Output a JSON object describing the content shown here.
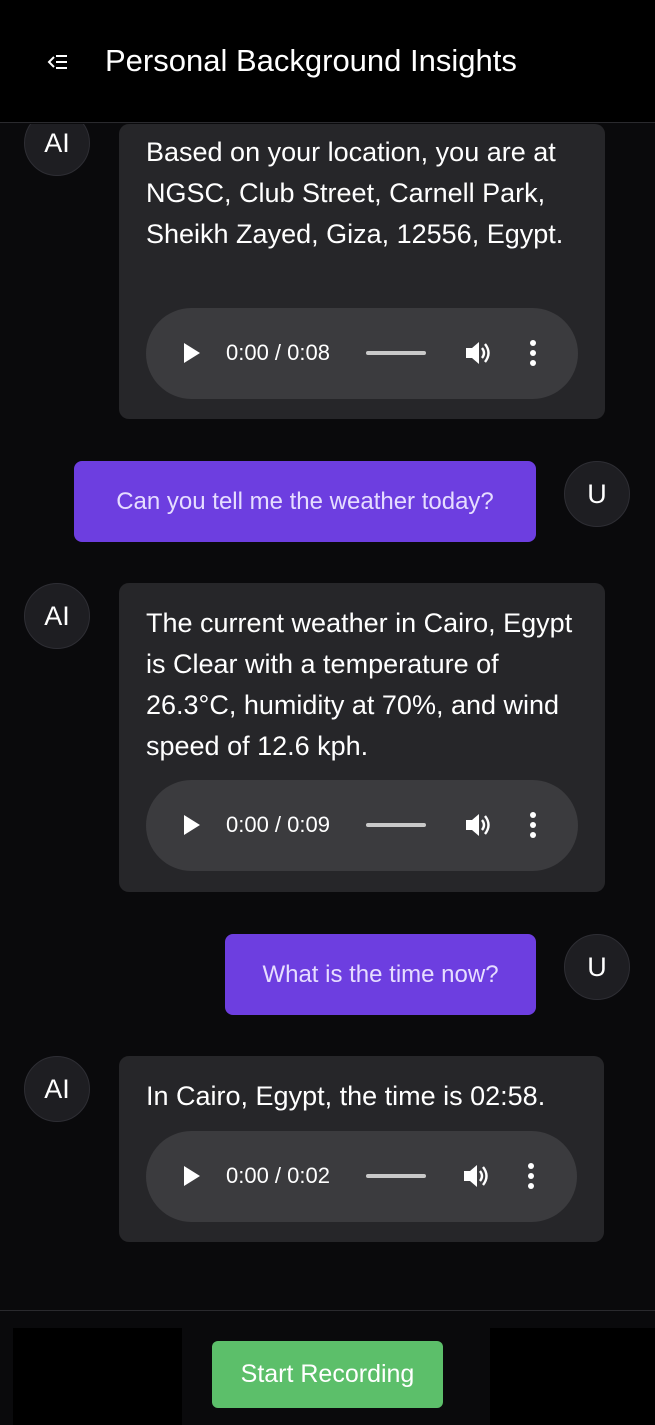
{
  "header": {
    "title": "Personal Background Insights",
    "menu_icon": "menu-collapse-icon"
  },
  "messages": [
    {
      "role": "ai",
      "avatar": "AI",
      "text": "Based on your location, you are at NGSC, Club Street, Carnell Park, Sheikh Zayed, Giza, 12556, Egypt.",
      "audio": {
        "current": "0:00",
        "duration": "0:08",
        "time_label": "0:00 / 0:08"
      }
    },
    {
      "role": "user",
      "avatar": "U",
      "text": "Can you tell me the weather today?"
    },
    {
      "role": "ai",
      "avatar": "AI",
      "text": "The current weather in Cairo, Egypt is Clear with a temperature of 26.3°C, humidity at 70%, and wind speed of 12.6 kph.",
      "audio": {
        "current": "0:00",
        "duration": "0:09",
        "time_label": "0:00 / 0:09"
      }
    },
    {
      "role": "user",
      "avatar": "U",
      "text": "What is the time now?"
    },
    {
      "role": "ai",
      "avatar": "AI",
      "text": "In Cairo, Egypt, the time is 02:58.",
      "audio": {
        "current": "0:00",
        "duration": "0:02",
        "time_label": "0:00 / 0:02"
      }
    }
  ],
  "footer": {
    "record_label": "Start Recording"
  },
  "colors": {
    "background": "#0a0a0c",
    "ai_bubble": "#262629",
    "user_bubble": "#6d3ee0",
    "record_button": "#5cbf6a"
  }
}
